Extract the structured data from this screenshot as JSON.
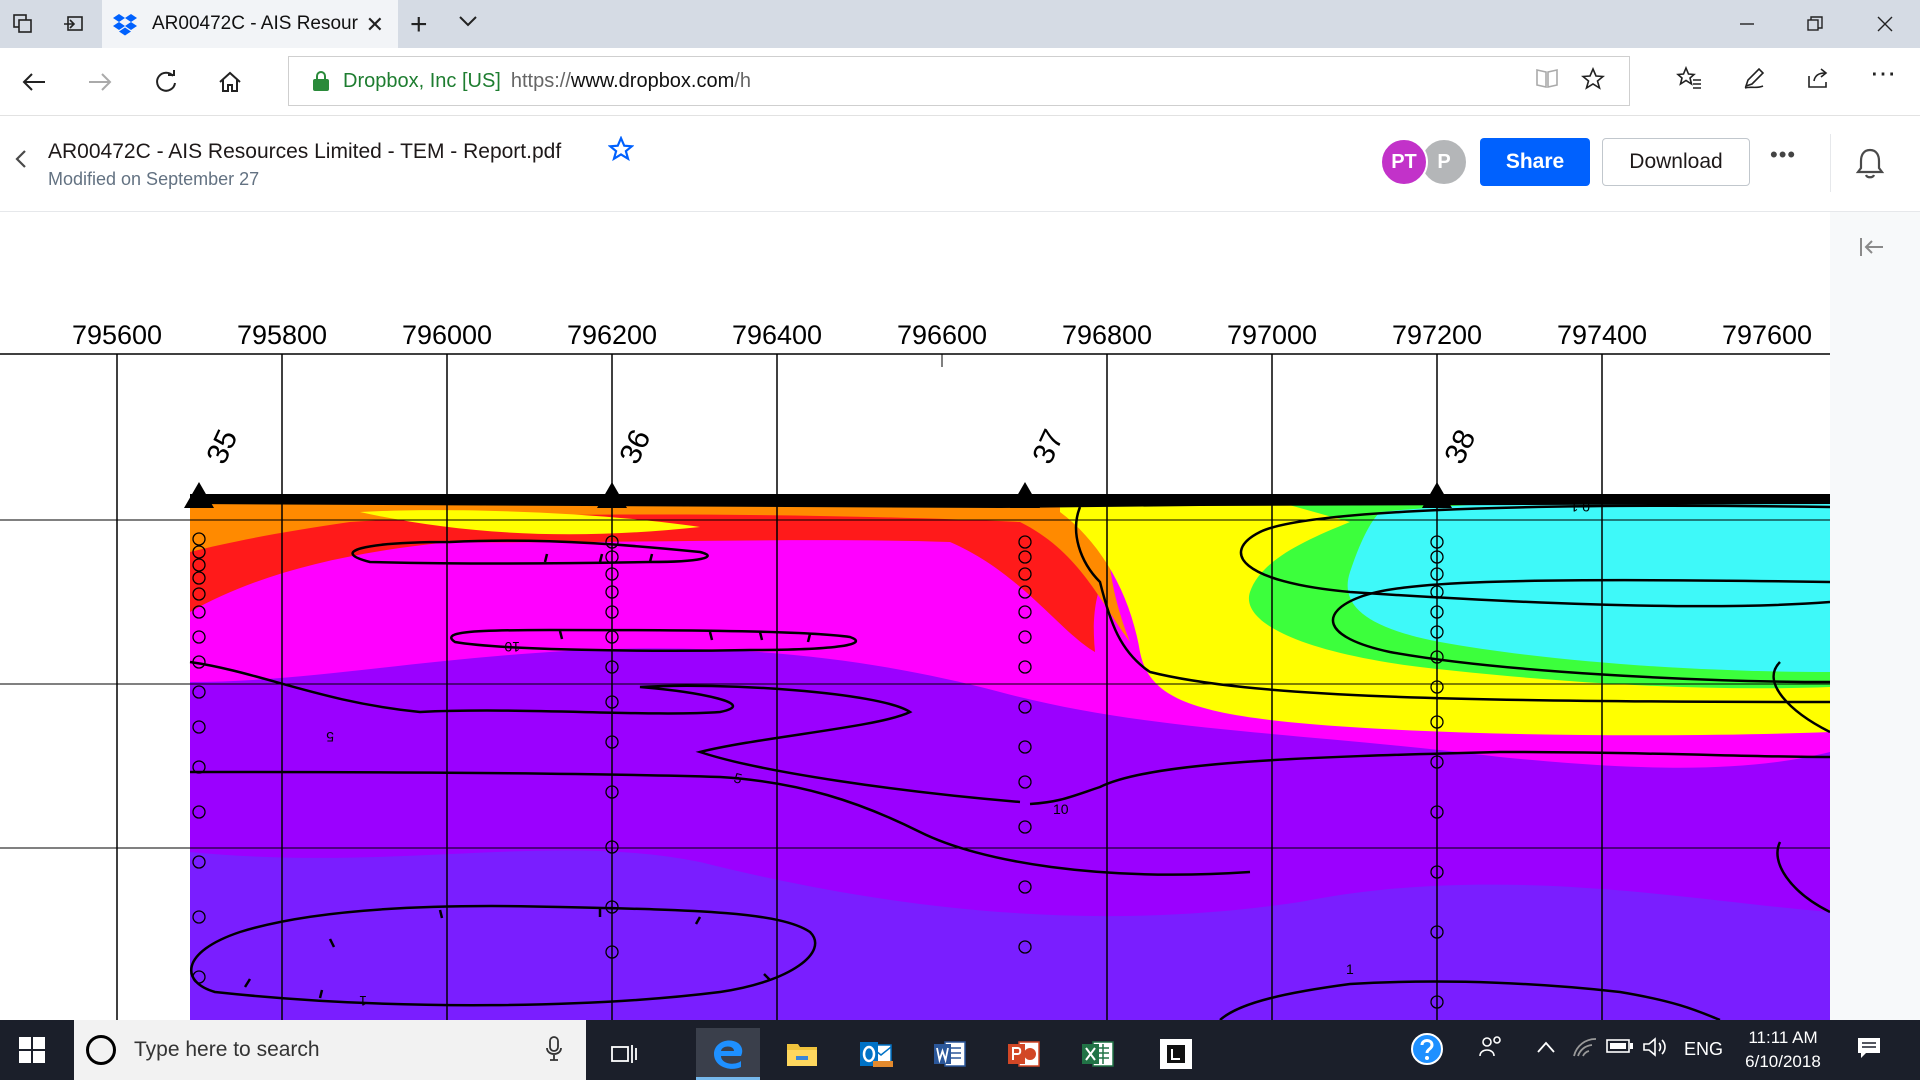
{
  "browser": {
    "tab": {
      "title": "AR00472C - AIS Resour"
    },
    "address": {
      "cert_owner": "Dropbox, Inc [US]",
      "url_scheme": "https://",
      "url_host": "www.dropbox.com",
      "url_path": "/h"
    }
  },
  "header": {
    "file_title": "AR00472C - AIS Resources Limited - TEM - Report.pdf",
    "modified": "Modified on September 27",
    "avatars": [
      {
        "initials": "PT",
        "color": "#c232c9"
      },
      {
        "initials": "P",
        "color": "#b4b6b8"
      }
    ],
    "share_label": "Share",
    "download_label": "Download"
  },
  "section": {
    "x_ticks": [
      "795600",
      "795800",
      "796000",
      "796200",
      "796400",
      "796600",
      "796800",
      "797000",
      "797200",
      "797400",
      "797600"
    ],
    "stations": [
      "35",
      "36",
      "37",
      "38"
    ],
    "contour_labels": [
      "10",
      "5",
      "5",
      "10",
      "1",
      "1",
      "0.1"
    ],
    "colors": {
      "magenta": "#ff00ff",
      "purple": "#9b00ff",
      "violet": "#7a1eff",
      "red": "#ff1a1a",
      "orange": "#ff8a00",
      "yellow": "#ffff00",
      "green": "#3cff3c",
      "cyan": "#3ef9f9"
    }
  },
  "taskbar": {
    "search_placeholder": "Type here to search",
    "language": "ENG",
    "time": "11:11 AM",
    "date": "6/10/2018"
  }
}
